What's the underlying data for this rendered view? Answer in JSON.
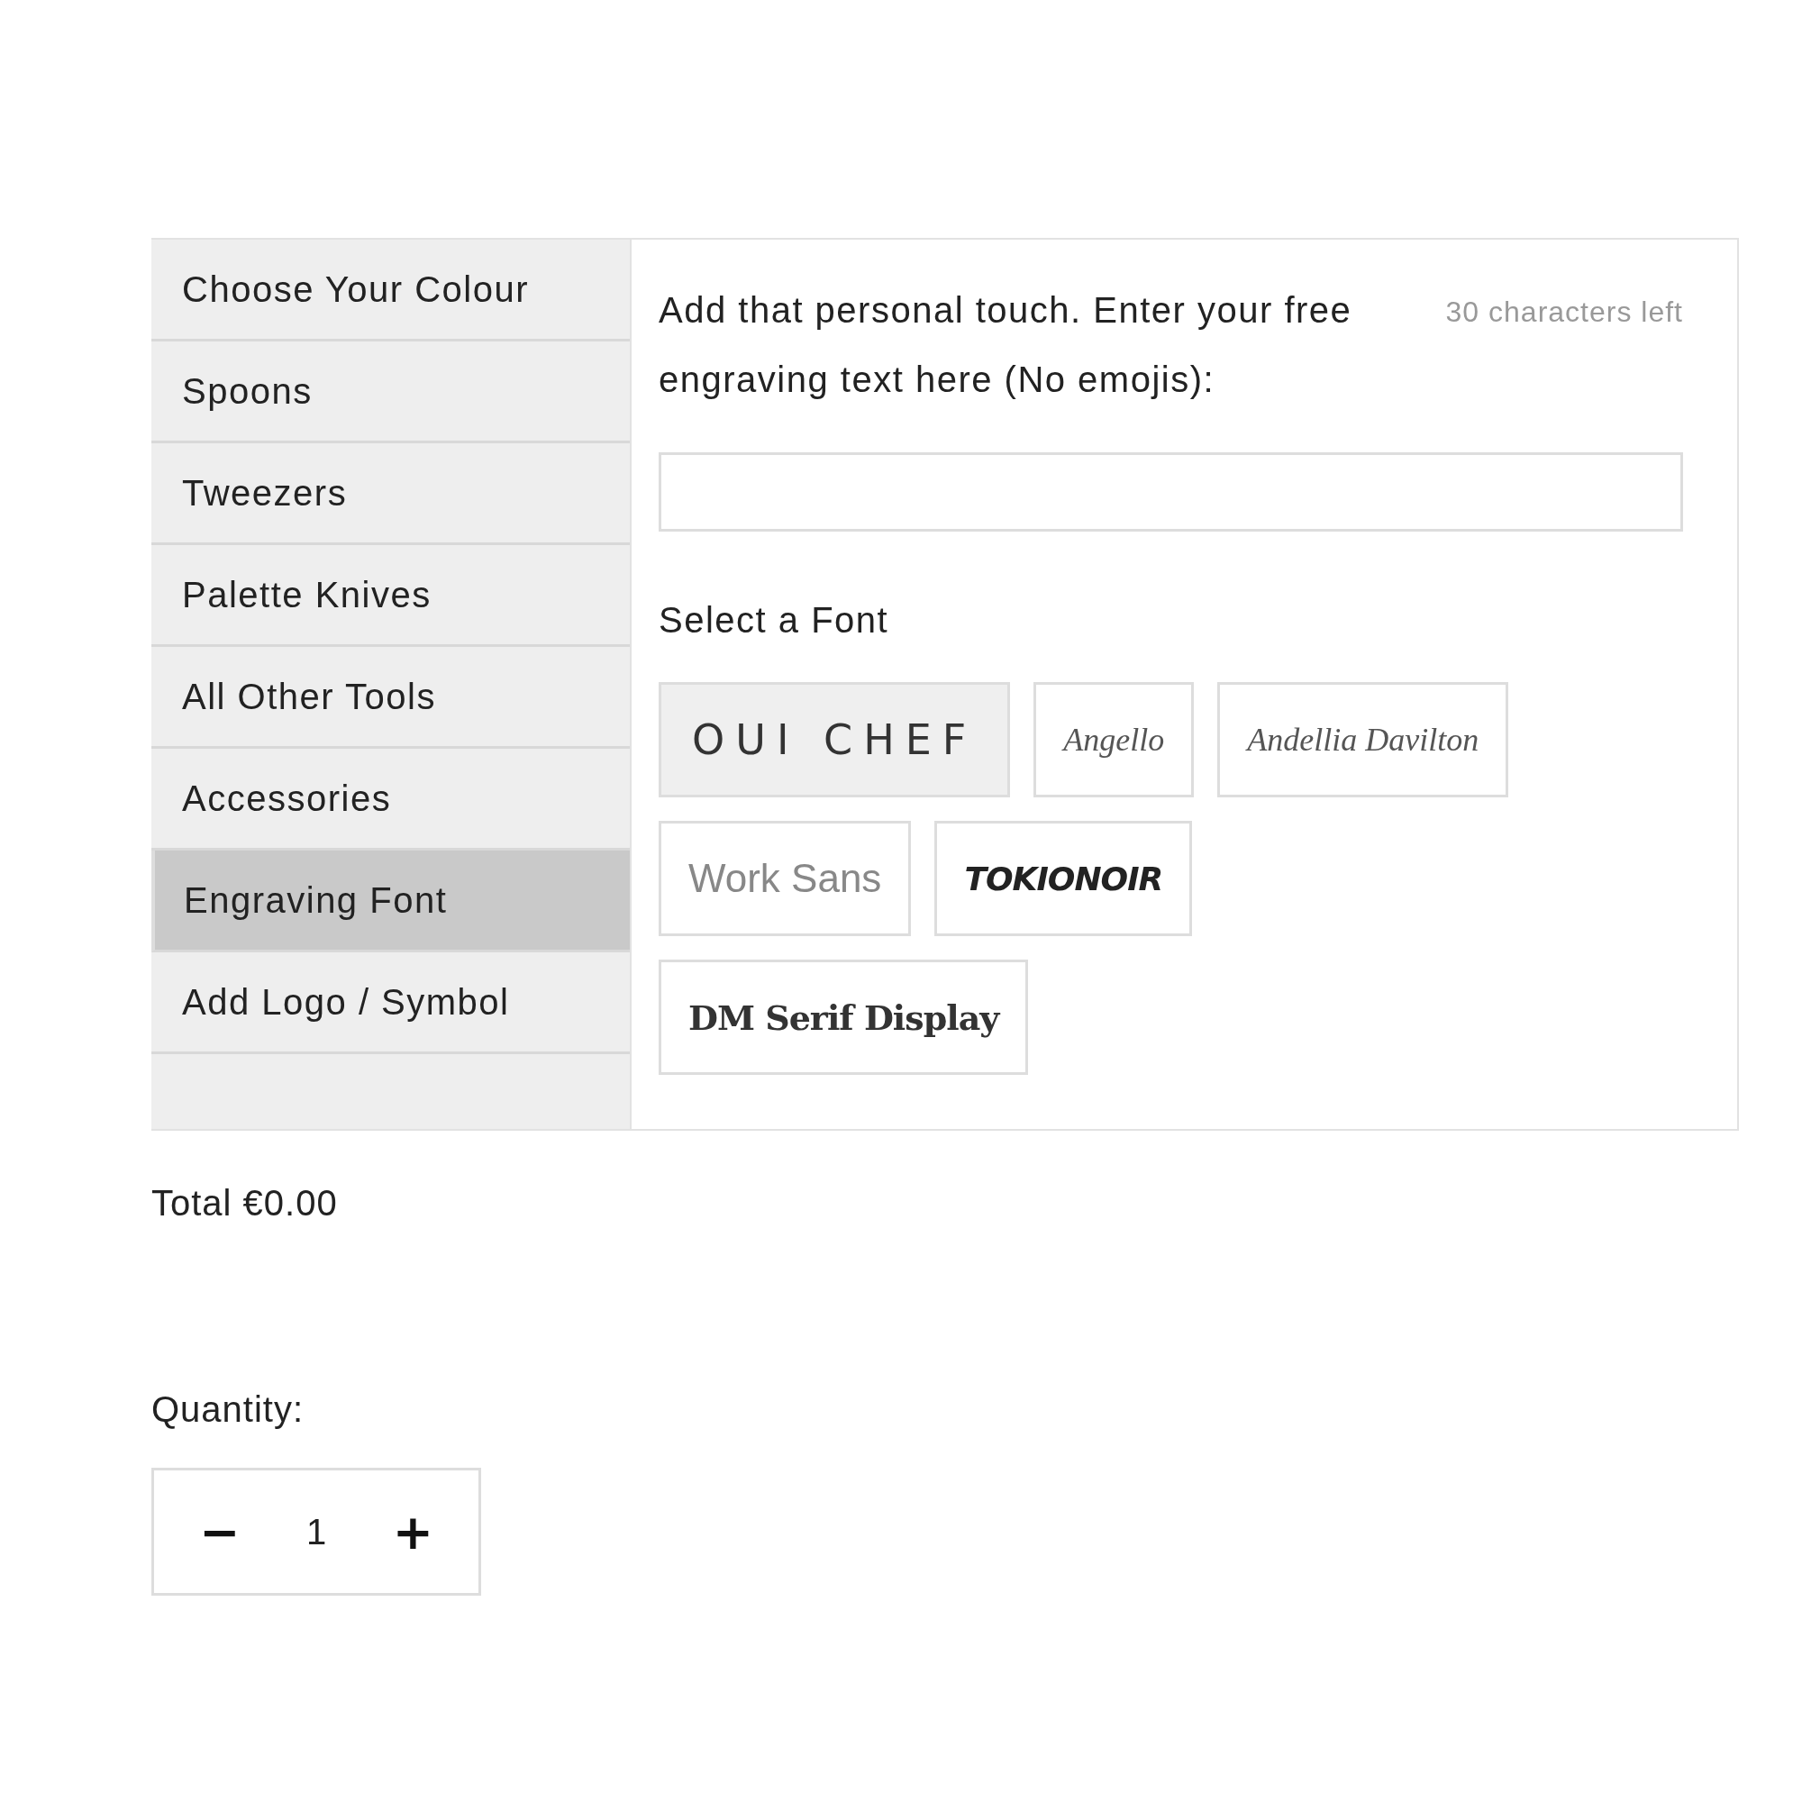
{
  "sidebar": {
    "items": [
      {
        "label": "Choose Your Colour",
        "selected": false
      },
      {
        "label": "Spoons",
        "selected": false
      },
      {
        "label": "Tweezers",
        "selected": false
      },
      {
        "label": "Palette Knives",
        "selected": false
      },
      {
        "label": "All Other Tools",
        "selected": false
      },
      {
        "label": "Accessories",
        "selected": false
      },
      {
        "label": "Engraving Font",
        "selected": true
      },
      {
        "label": "Add Logo / Symbol",
        "selected": false
      }
    ]
  },
  "engraving": {
    "prompt": "Add that personal touch. Enter your free engraving text here (No emojis):",
    "counter": "30 characters left",
    "font_heading": "Select a Font",
    "fonts": [
      {
        "label": "OUI CHEF",
        "kind": "wide",
        "selected": true
      },
      {
        "label": "Angello",
        "kind": "script",
        "selected": false
      },
      {
        "label": "Andellia Davilton",
        "kind": "script",
        "selected": false
      },
      {
        "label": "Work Sans",
        "kind": "thin",
        "selected": false
      },
      {
        "label": "TOKIONOIR",
        "kind": "brush",
        "selected": false
      },
      {
        "label": "DM Serif Display",
        "kind": "serif",
        "selected": false
      }
    ]
  },
  "total": "Total €0.00",
  "quantity": {
    "label": "Quantity:",
    "minus": "−",
    "value": "1",
    "plus": "+"
  }
}
